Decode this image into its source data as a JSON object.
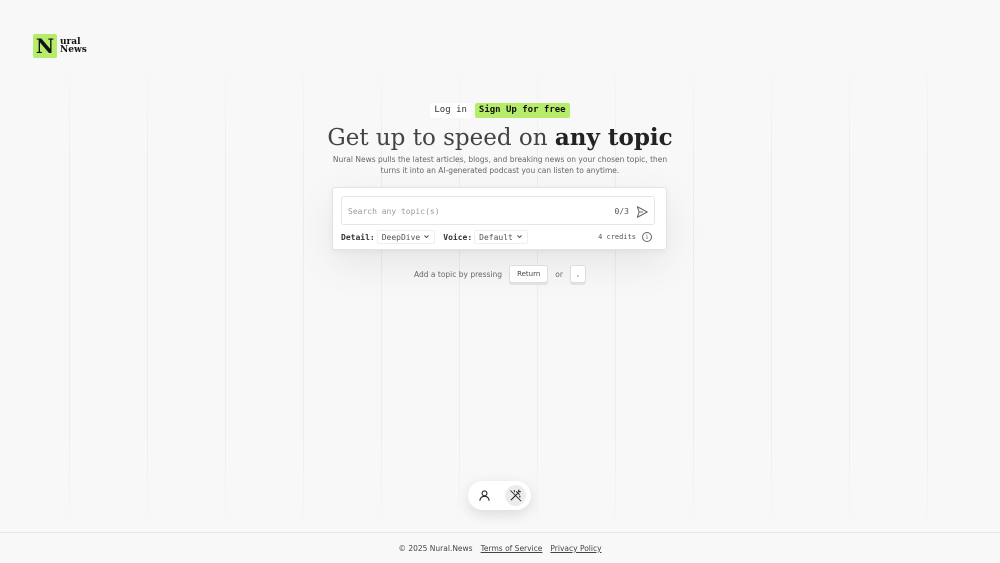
{
  "logo": {
    "mark": "N",
    "line1": "ural",
    "line2": "News"
  },
  "auth": {
    "login_label": "Log in",
    "signup_label": "Sign Up for free"
  },
  "hero": {
    "headline_prefix": "Get up to speed on ",
    "headline_emphasis": "any topic",
    "subtitle": "Nural News pulls the latest articles, blogs, and breaking news on your chosen topic, then turns it into an AI-generated podcast you can listen to anytime."
  },
  "search": {
    "placeholder": "Search any topic(s)",
    "value": "",
    "counter": "0/3"
  },
  "controls": {
    "detail_label": "Detail:",
    "detail_value": "DeepDive",
    "voice_label": "Voice:",
    "voice_value": "Default",
    "credits": "4 credits"
  },
  "hint": {
    "prefix": "Add a topic by pressing",
    "key_return": "Return",
    "or": "or",
    "key_comma": ","
  },
  "footer": {
    "copyright": "© 2025 Nural.News",
    "terms": "Terms of Service",
    "privacy": "Privacy Policy"
  },
  "colors": {
    "accent": "#b7ec6a",
    "background": "#f8f8f8"
  },
  "icons": {
    "send": "send-arrow-icon",
    "info": "info-icon",
    "chevron": "chevron-down-icon",
    "user": "user-icon",
    "magic": "magic-wand-icon"
  }
}
